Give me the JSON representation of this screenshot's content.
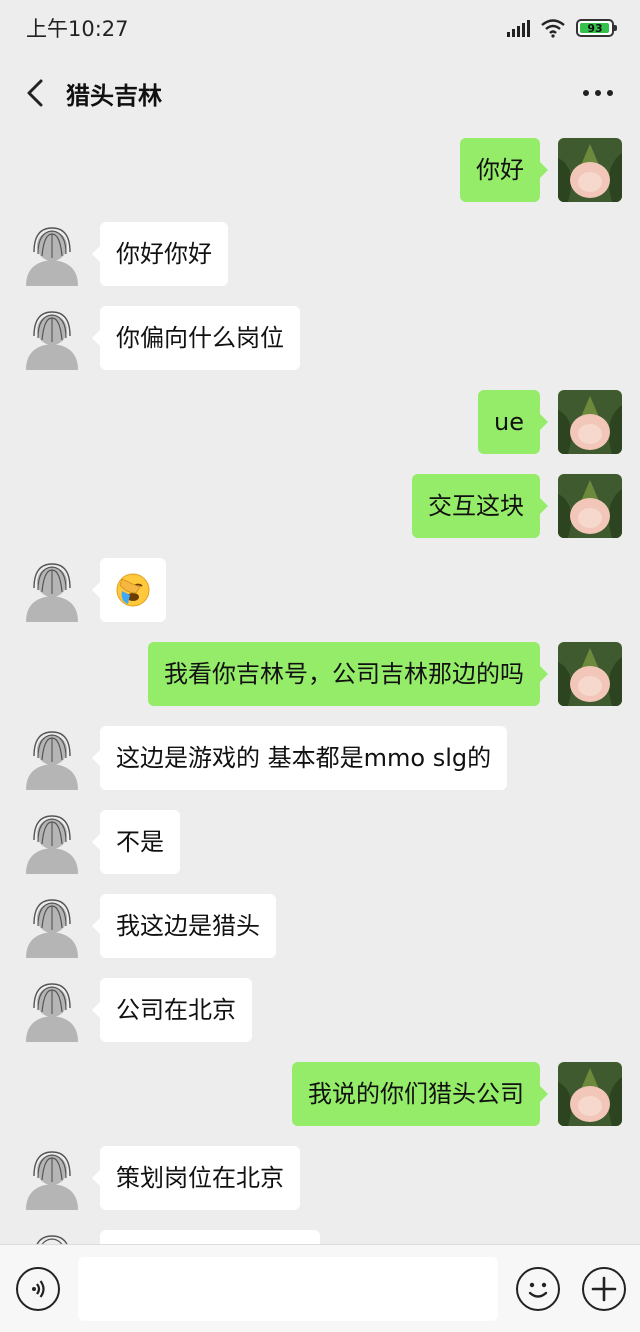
{
  "status_bar": {
    "time": "上午10:27",
    "battery": "93",
    "battery_color": "#35c24a"
  },
  "header": {
    "title": "猎头吉林",
    "back_icon": "chevron-left-icon",
    "more_icon": "more-dots-icon"
  },
  "colors": {
    "sent_bubble": "#95ec69",
    "received_bubble": "#ffffff",
    "background": "#ededed"
  },
  "messages": [
    {
      "from": "me",
      "text": "你好"
    },
    {
      "from": "them",
      "text": "你好你好"
    },
    {
      "from": "them",
      "text": "你偏向什么岗位"
    },
    {
      "from": "me",
      "text": "ue"
    },
    {
      "from": "me",
      "text": "交互这块"
    },
    {
      "from": "them",
      "emoji": "facepalm-emoji"
    },
    {
      "from": "me",
      "text": "我看你吉林号，公司吉林那边的吗"
    },
    {
      "from": "them",
      "text": "这边是游戏的 基本都是mmo slg的"
    },
    {
      "from": "them",
      "text": "不是"
    },
    {
      "from": "them",
      "text": "我这边是猎头"
    },
    {
      "from": "them",
      "text": "公司在北京"
    },
    {
      "from": "me",
      "text": "我说的你们猎头公司"
    },
    {
      "from": "them",
      "text": "策划岗位在北京"
    }
  ],
  "input_bar": {
    "value": "",
    "voice_icon": "voice-icon",
    "emoji_icon": "emoji-icon",
    "plus_icon": "plus-icon"
  }
}
